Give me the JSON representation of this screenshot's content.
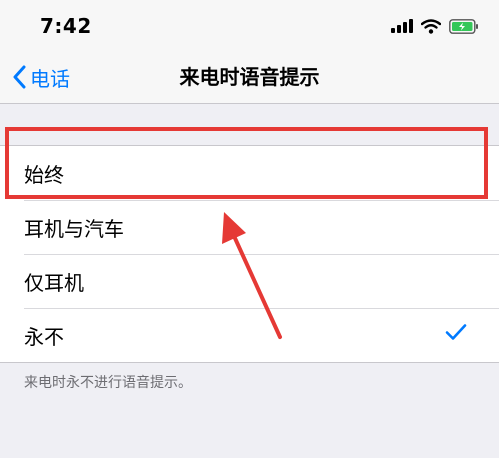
{
  "status_bar": {
    "time": "7:42",
    "icons": [
      "cellular-signal-icon",
      "wifi-icon",
      "battery-charging-icon"
    ]
  },
  "nav": {
    "back_label": "电话",
    "title": "来电时语音提示"
  },
  "options": [
    {
      "label": "始终",
      "selected": false
    },
    {
      "label": "耳机与汽车",
      "selected": false
    },
    {
      "label": "仅耳机",
      "selected": false
    },
    {
      "label": "永不",
      "selected": true
    }
  ],
  "footer_note": "来电时永不进行语音提示。",
  "colors": {
    "accent": "#007aff",
    "highlight": "#e53935",
    "battery": "#34c759",
    "background": "#efeff4"
  }
}
